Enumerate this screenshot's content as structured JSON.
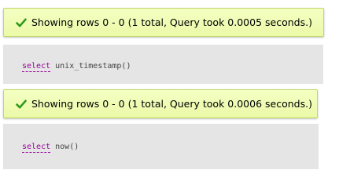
{
  "results": [
    {
      "status_icon": "check-icon",
      "message": "Showing rows 0 - 0 (1 total, Query took 0.0005 seconds.)",
      "query_keyword": "select",
      "query_rest": " unix_timestamp()"
    },
    {
      "status_icon": "check-icon",
      "message": "Showing rows 0 - 0 (1 total, Query took 0.0006 seconds.)",
      "query_keyword": "select",
      "query_rest": " now()"
    }
  ],
  "colors": {
    "success_bg": "#ebf9a8",
    "success_border": "#bfd96a",
    "check_green": "#2e9a17",
    "query_bg": "#e5e5e5",
    "keyword": "#990099"
  }
}
